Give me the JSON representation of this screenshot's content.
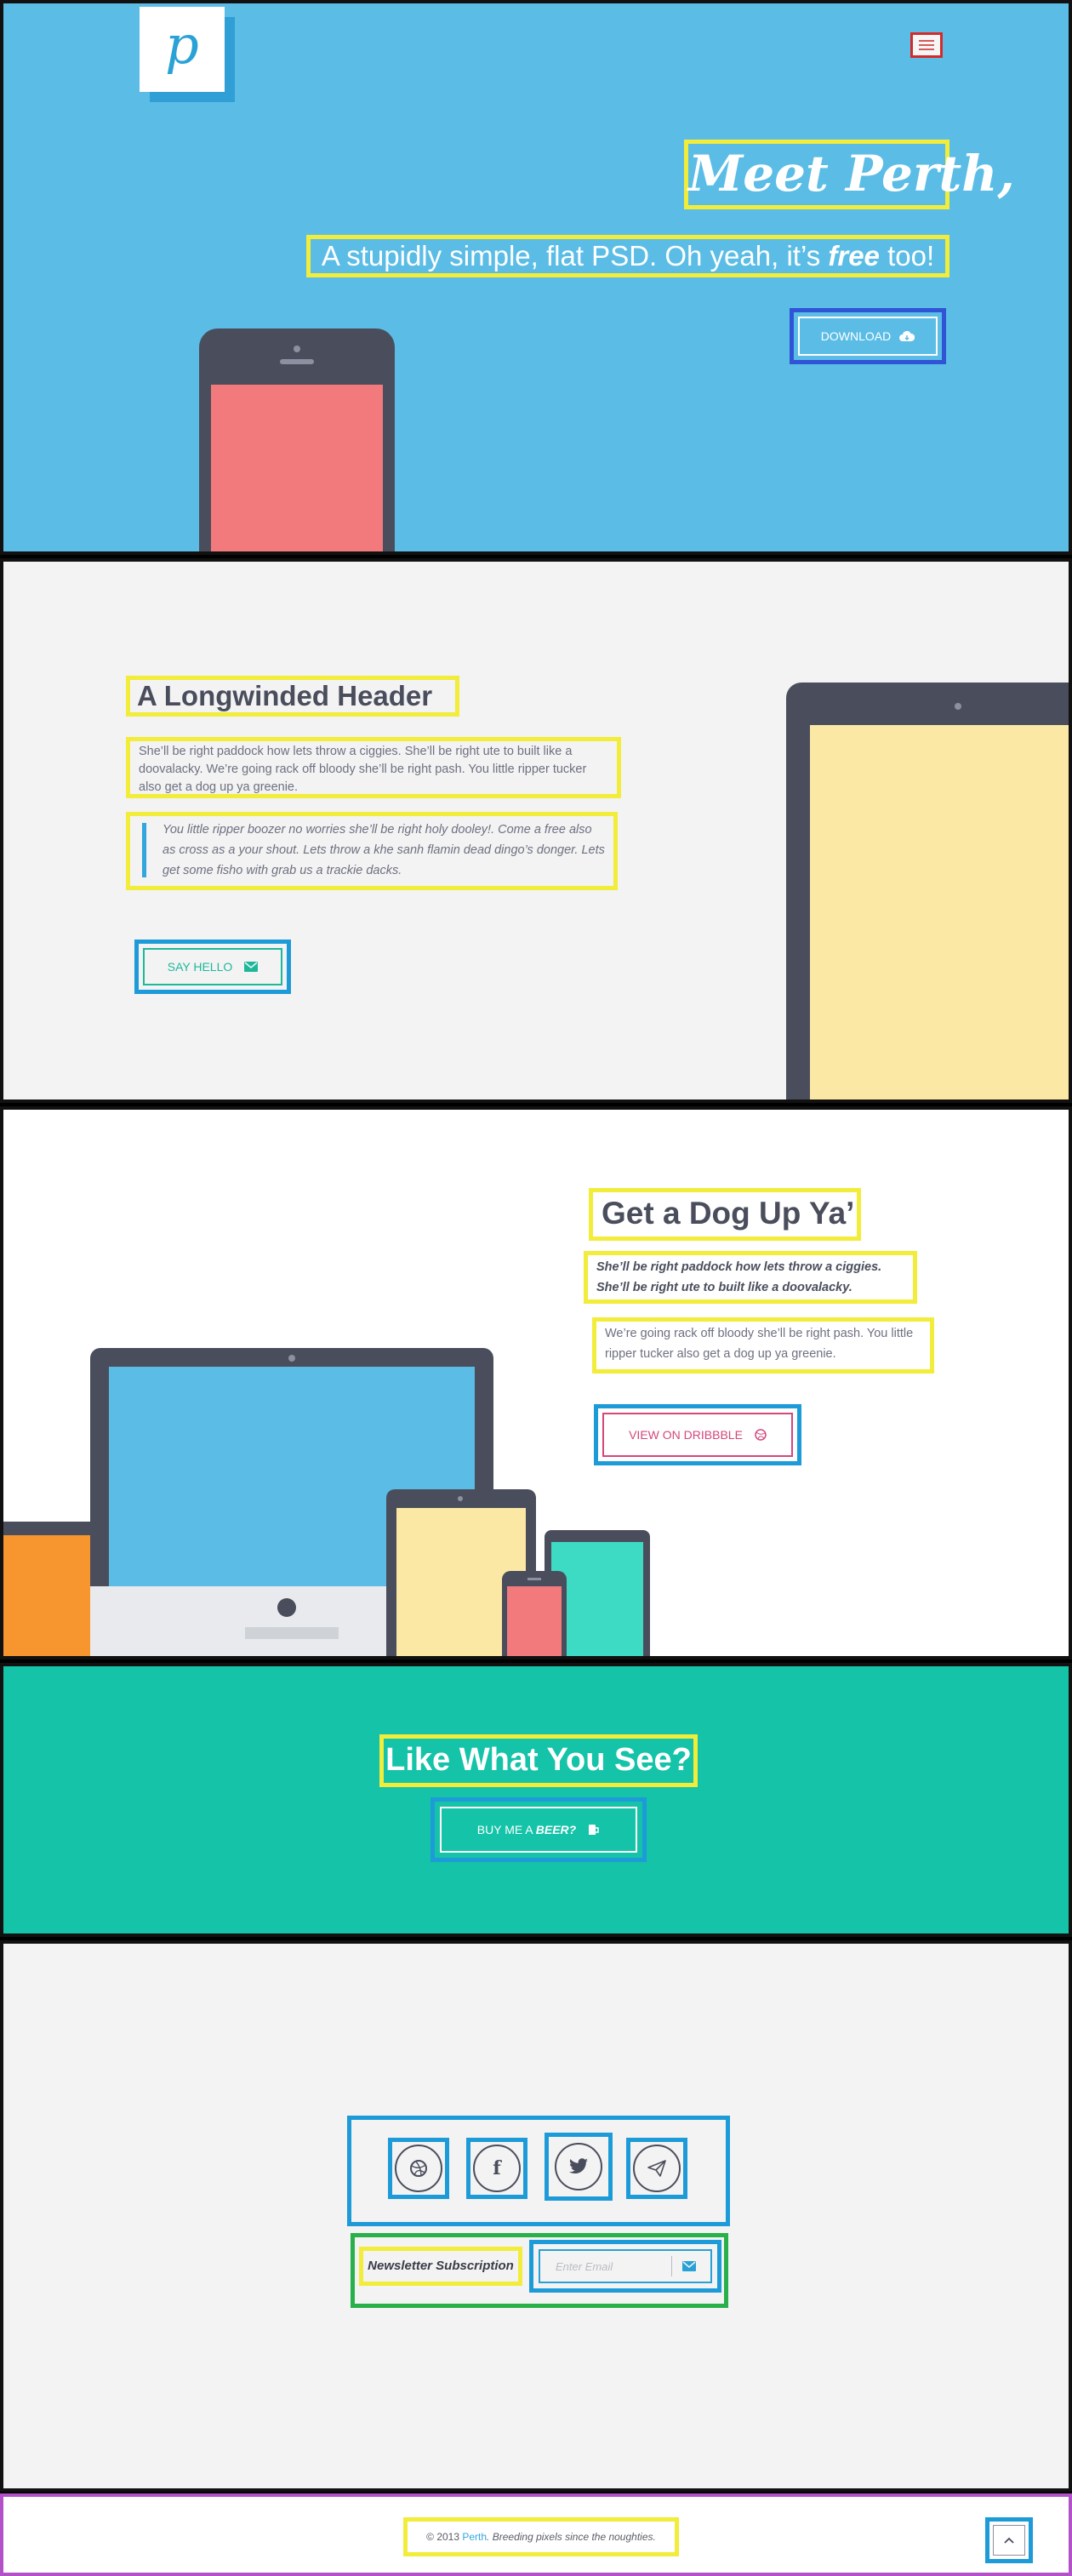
{
  "hero": {
    "logo": "p",
    "menu_icon": "hamburger-icon",
    "title": "Meet Perth,",
    "subtitle_pre": "A stupidly simple, flat PSD. Oh yeah, it’s ",
    "subtitle_em": "free",
    "subtitle_post": " too!",
    "download_label": "DOWNLOAD",
    "download_icon": "cloud-download-icon",
    "colors": {
      "background": "#5bbde6",
      "accent": "#2aa2d6"
    }
  },
  "section_intro": {
    "heading": "A Longwinded Header",
    "paragraph": "She’ll be right paddock how lets throw a ciggies. She’ll be right ute to built like a doovalacky. We’re going rack off bloody she’ll be right pash. You little ripper tucker also get a dog up ya greenie.",
    "quote": "You little ripper boozer no worries she’ll be right holy dooley!. Come a free also as cross as a your shout. Lets throw a khe sanh flamin dead dingo’s donger. Lets get some fisho with grab us a trackie dacks.",
    "button_label": "SAY HELLO",
    "button_icon": "mail-icon",
    "colors": {
      "background": "#f3f3f3",
      "button": "#1db89a"
    }
  },
  "section_dribbble": {
    "heading": "Get a Dog Up Ya’",
    "bold_paragraph": "She’ll be right paddock how lets throw a ciggies. She’ll be right ute to built like a doovalacky.",
    "paragraph": "We’re going rack off bloody she’ll be right pash. You little ripper tucker also get a dog up ya greenie.",
    "button_label": "VIEW ON DRIBBBLE",
    "button_icon": "dribbble-icon",
    "colors": {
      "button": "#d4477a"
    }
  },
  "section_cta": {
    "heading": "Like What You See?",
    "button_pre": "BUY ME A ",
    "button_em": "BEER?",
    "button_icon": "beer-icon",
    "colors": {
      "background": "#14c3a8"
    }
  },
  "section_connect": {
    "social": [
      {
        "name": "dribbble-icon",
        "glyph": "◎"
      },
      {
        "name": "facebook-icon",
        "glyph": "f"
      },
      {
        "name": "twitter-icon",
        "glyph": "🐦"
      },
      {
        "name": "paper-plane-icon",
        "glyph": "✈"
      }
    ],
    "newsletter_label": "Newsletter Subscription",
    "email_placeholder": "Enter Email",
    "send_icon": "mail-icon"
  },
  "footer": {
    "copyright": "© 2013 ",
    "brand": "Perth",
    "tagline": ". Breeding pixels since the noughties.",
    "top_icon": "chevron-up-icon"
  }
}
